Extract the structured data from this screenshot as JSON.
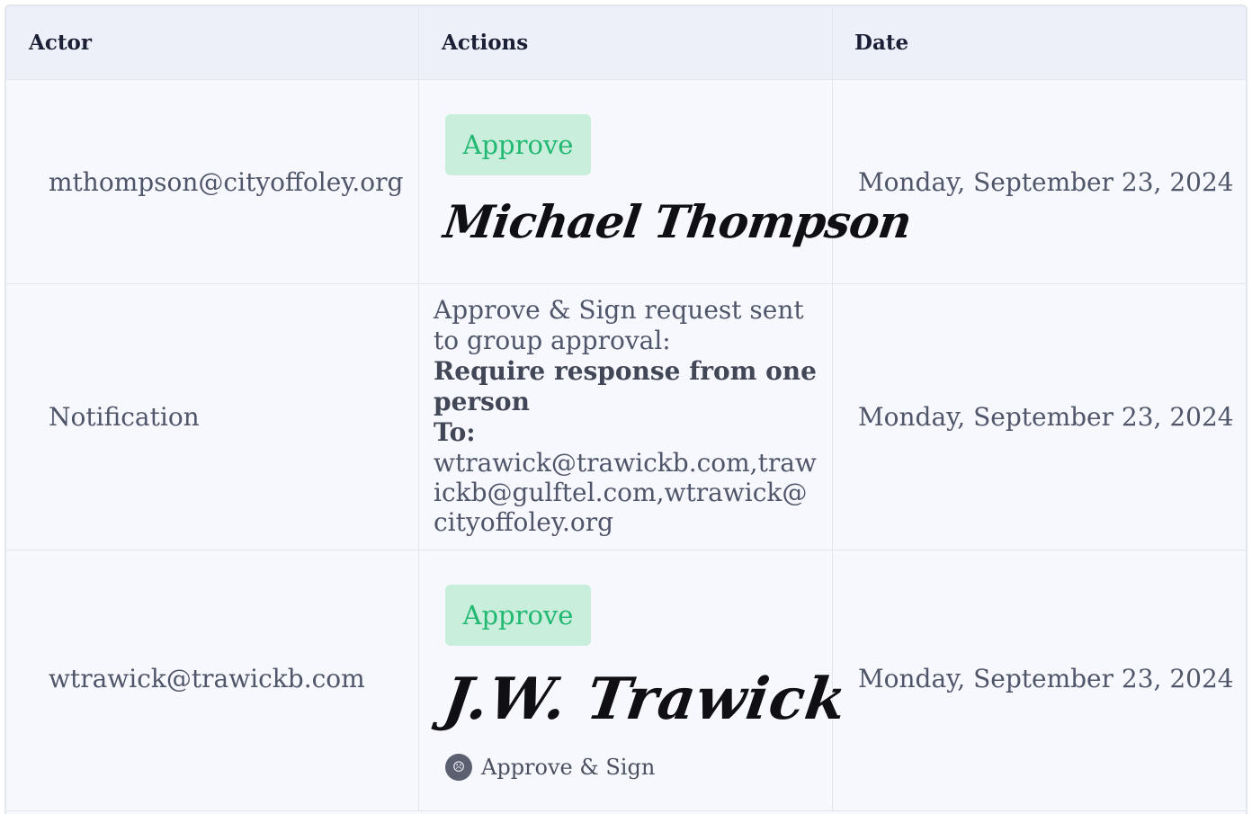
{
  "table": {
    "headers": {
      "actor": "Actor",
      "actions": "Actions",
      "date": "Date"
    },
    "rows": [
      {
        "actor": "mthompson@cityoffoley.org",
        "action_button": "Approve",
        "signature": "Michael Thompson",
        "date": "Monday, September 23, 2024"
      },
      {
        "actor": "Notification",
        "message": "Approve & Sign request sent to group approval:",
        "requirement": "Require response from one person",
        "to_label": "To:",
        "recipients": "wtrawick@trawickb.com,trawickb@gulftel.com,wtrawick@cityoffoley.org",
        "date": "Monday, September 23, 2024"
      },
      {
        "actor": "wtrawick@trawickb.com",
        "action_button": "Approve",
        "signature": "J.W. Trawick",
        "method_icon": "user-avatar-icon",
        "method": "Approve & Sign",
        "date": "Monday, September 23, 2024"
      }
    ]
  }
}
